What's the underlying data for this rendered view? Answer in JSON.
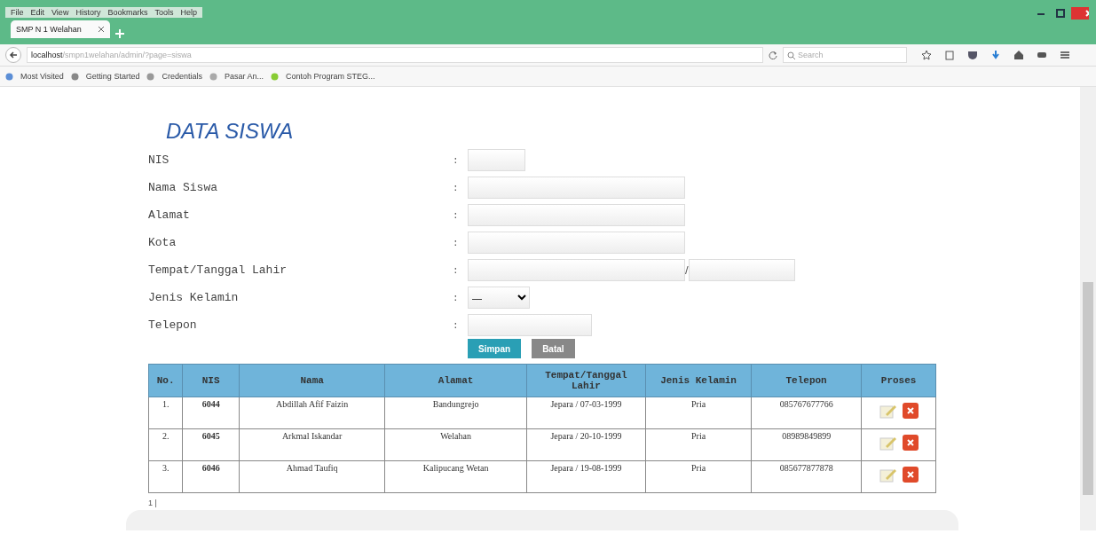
{
  "browser": {
    "menu": [
      "File",
      "Edit",
      "View",
      "History",
      "Bookmarks",
      "Tools",
      "Help"
    ],
    "tabs": [
      {
        "label": "SMP N 1 Welahan",
        "selected": true
      }
    ],
    "url": {
      "host": "localhost",
      "path": "/smpn1welahan/admin/?page=siswa"
    },
    "search": {
      "placeholder": "Search"
    },
    "bookmarks": [
      "Most Visited",
      "Getting Started",
      "Credentials",
      "Pasar An...",
      "Contoh Program STEG..."
    ]
  },
  "page": {
    "title": "DATA SISWA",
    "form": {
      "separator": ":",
      "fields": [
        {
          "kind": "short",
          "label": "NIS"
        },
        {
          "kind": "long",
          "label": "Nama Siswa"
        },
        {
          "kind": "long",
          "label": "Alamat"
        },
        {
          "kind": "long",
          "label": "Kota"
        },
        {
          "kind": "pair",
          "label": "Tempat/Tanggal Lahir",
          "joiner": "/"
        },
        {
          "kind": "select",
          "label": "Jenis Kelamin",
          "value": "—"
        },
        {
          "kind": "medium",
          "label": "Telepon"
        }
      ],
      "buttons": [
        {
          "label": "Simpan",
          "kind": "primary"
        },
        {
          "label": "Batal",
          "kind": "secondary"
        }
      ]
    },
    "table": {
      "columns": [
        "No.",
        "NIS",
        "Nama",
        "Alamat",
        "Tempat/Tanggal Lahir",
        "Jenis Kelamin",
        "Telepon",
        "Proses"
      ],
      "rows": [
        [
          "1.",
          "6044",
          "Abdillah Afif Faizin",
          "Bandungrejo",
          "Jepara / 07-03-1999",
          "Pria",
          "085767677766"
        ],
        [
          "2.",
          "6045",
          "Arkmal Iskandar",
          "Welahan",
          "Jepara / 20-10-1999",
          "Pria",
          "08989849899"
        ],
        [
          "3.",
          "6046",
          "Ahmad Taufiq",
          "Kalipucang Wetan",
          "Jepara / 19-08-1999",
          "Pria",
          "085677877878"
        ]
      ]
    },
    "pagination": "1 |"
  }
}
